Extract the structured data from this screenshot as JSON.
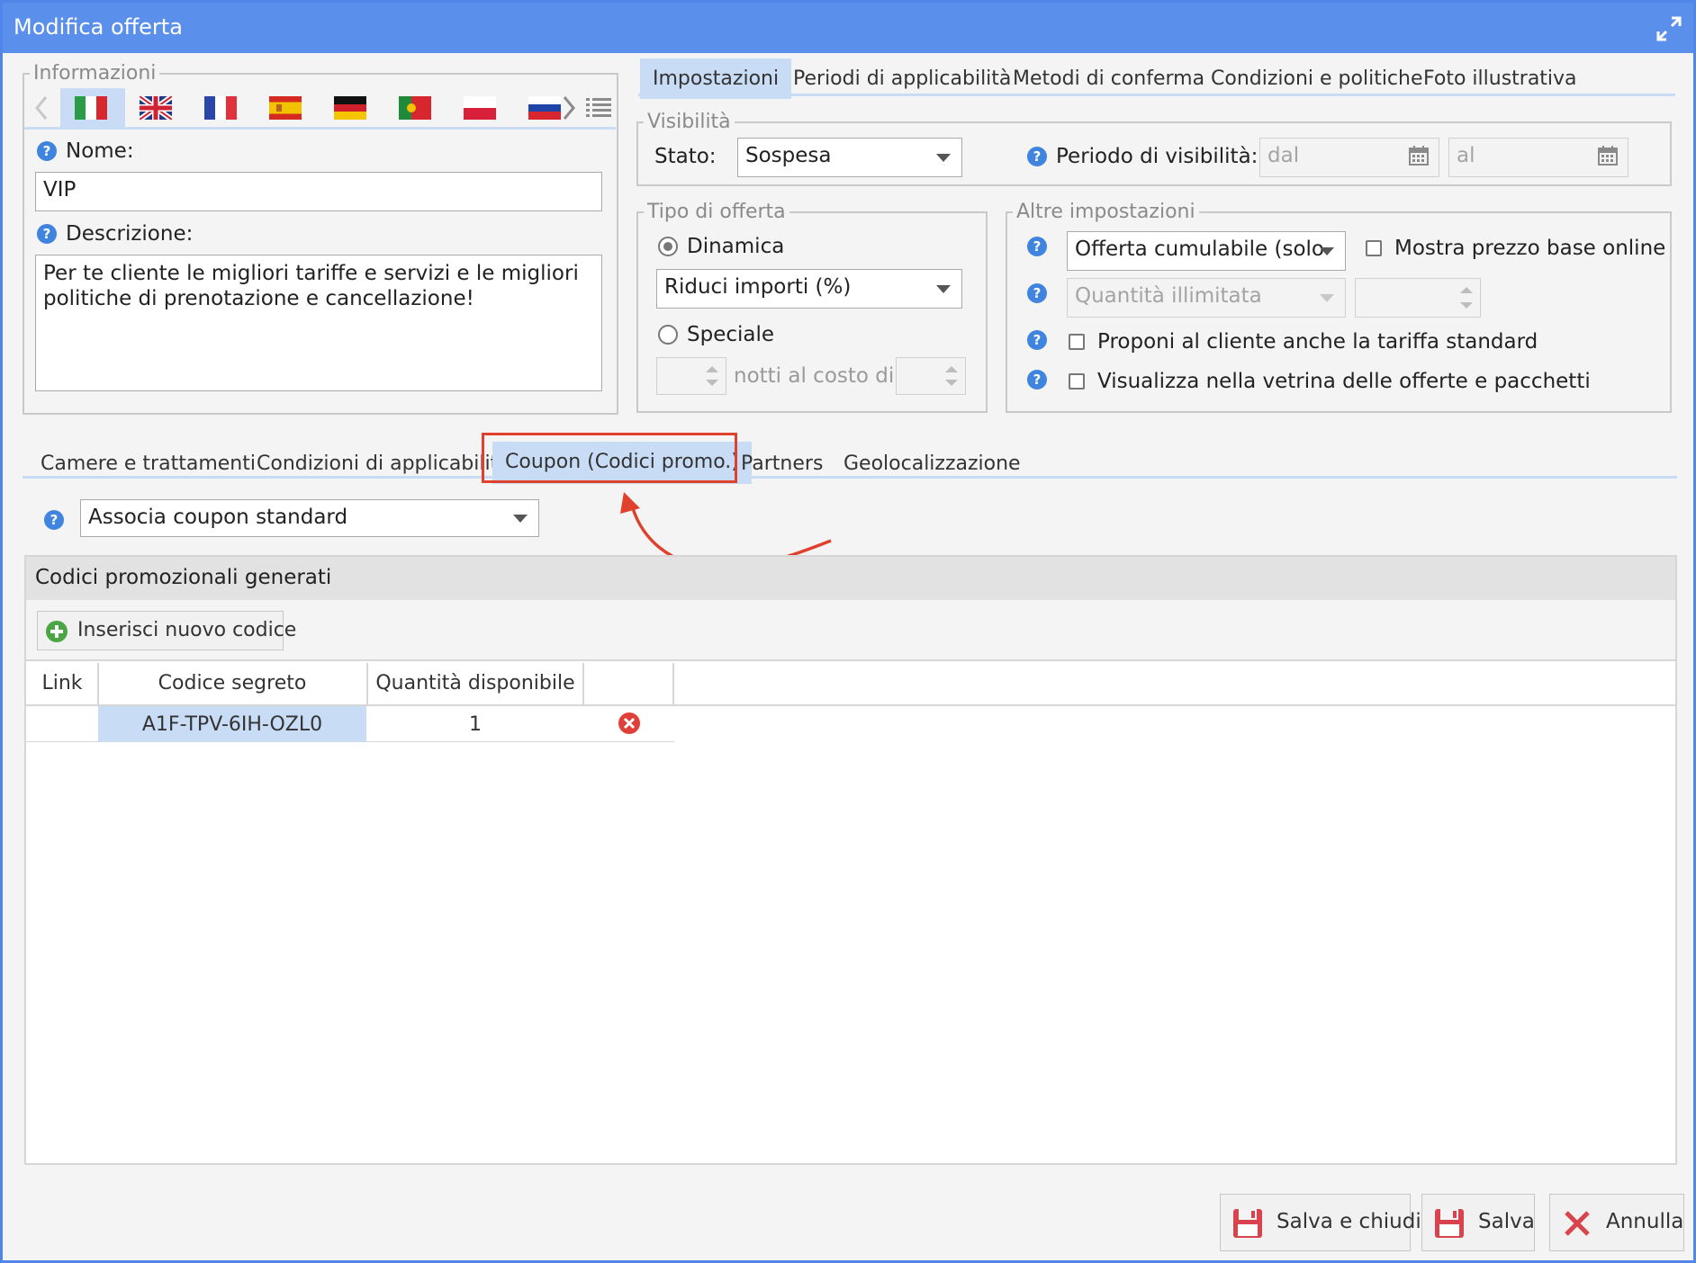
{
  "window": {
    "title": "Modifica offerta",
    "expand_icon": "expand-icon"
  },
  "informazioni": {
    "legend": "Informazioni",
    "flags": [
      "italy-flag-icon",
      "uk-flag-icon",
      "france-flag-icon",
      "spain-flag-icon",
      "germany-flag-icon",
      "portugal-flag-icon",
      "poland-flag-icon",
      "russia-flag-icon"
    ],
    "nome_label": "Nome:",
    "nome_value": "VIP",
    "descrizione_label": "Descrizione:",
    "descrizione_value": "Per te cliente le migliori tariffe e servizi e le migliori politiche di prenotazione e cancellazione!"
  },
  "top_tabs": [
    "Impostazioni",
    "Periodi di applicabilità",
    "Metodi di conferma",
    "Condizioni e politiche",
    "Foto illustrativa"
  ],
  "visibilita": {
    "legend": "Visibilità",
    "stato_label": "Stato:",
    "stato_value": "Sospesa",
    "periodo_label": "Periodo di visibilità:",
    "dal_placeholder": "dal",
    "al_placeholder": "al"
  },
  "tipo_offerta": {
    "legend": "Tipo di offerta",
    "dinamica_label": "Dinamica",
    "dinamica_select": "Riduci importi (%)",
    "speciale_label": "Speciale",
    "notti_label": "notti al costo di"
  },
  "altre_impostazioni": {
    "legend": "Altre impostazioni",
    "cumulabile_select": "Offerta cumulabile (solo",
    "mostra_prezzo_label": "Mostra prezzo base online",
    "quantita_select": "Quantità illimitata",
    "proponi_label": "Proponi al cliente anche la tariffa standard",
    "visualizza_label": "Visualizza nella vetrina delle offerte e pacchetti"
  },
  "bottom_tabs": [
    "Camere e trattamenti",
    "Condizioni di applicabilità",
    "Coupon (Codici promo.)",
    "Partners",
    "Geolocalizzazione"
  ],
  "coupon": {
    "associa_select": "Associa coupon standard",
    "panel_title": "Codici promozionali generati",
    "insert_button": "Inserisci nuovo codice",
    "columns": [
      "Link",
      "Codice segreto",
      "Quantità disponibile"
    ],
    "rows": [
      {
        "link": "",
        "codice": "A1F-TPV-6IH-OZL0",
        "quantita": "1"
      }
    ]
  },
  "footer": {
    "salva_chiudi": "Salva e chiudi",
    "salva": "Salva",
    "annulla": "Annulla"
  },
  "colors": {
    "titlebar": "#5b8fec",
    "highlight": "#e0412d",
    "active_tab": "#c9dcf5"
  }
}
